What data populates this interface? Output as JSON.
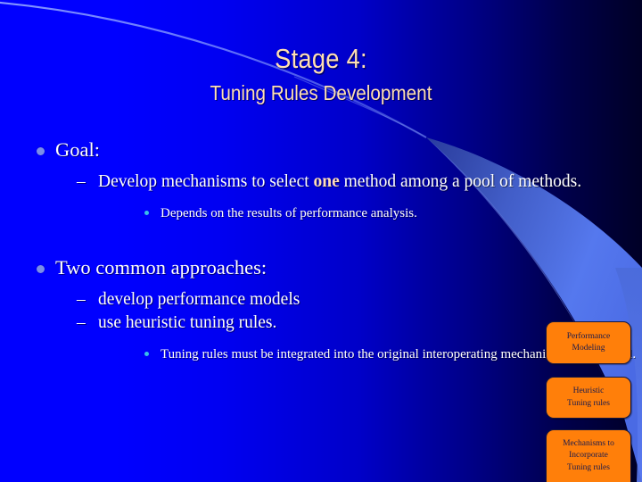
{
  "slide": {
    "title": "Stage 4:",
    "subtitle": "Tuning Rules Development",
    "title_color": "#ffdfb2",
    "body_text_color": "#ffffff",
    "background_left_color": "#0000ff",
    "background_right_color": "#000026",
    "accent_wedge_color": "#4a6fe0"
  },
  "bullets": {
    "goal_heading": "Goal:",
    "goal_sub_1_prefix": "Develop mechanisms to select ",
    "goal_sub_1_emphasis": "one",
    "goal_sub_1_suffix": " method among a pool of methods.",
    "goal_sub_1_detail": "Depends on the results of performance analysis.",
    "approaches_heading": "Two common approaches:",
    "approach_1": "develop performance models",
    "approach_2": "use heuristic tuning rules.",
    "approach_detail": "Tuning rules must be integrated into the original interoperating mechanisms to be useful.",
    "level1_bullet_color": "#7b8ee8",
    "level2_bullet_glyph": "–",
    "level3_bullet_color": "#39c0e8"
  },
  "callouts": {
    "box_color": "#ff7f0a",
    "text_color": "#1a1a4d",
    "items": [
      {
        "line1": "Performance",
        "line2": "Modeling",
        "line3": ""
      },
      {
        "line1": "Heuristic",
        "line2": "Tuning rules",
        "line3": ""
      },
      {
        "line1": "Mechanisms to",
        "line2": "Incorporate",
        "line3": "Tuning rules"
      }
    ]
  }
}
